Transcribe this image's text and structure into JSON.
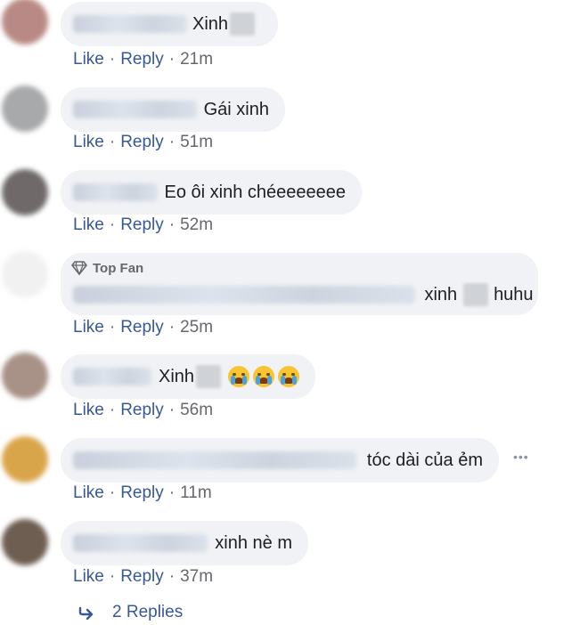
{
  "comments": [
    {
      "text": "Xinh",
      "like": "Like",
      "reply": "Reply",
      "time": "21m"
    },
    {
      "text": "Gái xinh",
      "like": "Like",
      "reply": "Reply",
      "time": "51m"
    },
    {
      "text": "Eo ôi xinh chéeeeeeee",
      "like": "Like",
      "reply": "Reply",
      "time": "52m"
    },
    {
      "badge": "Top Fan",
      "text_a": "xinh",
      "text_b": "huhu",
      "like": "Like",
      "reply": "Reply",
      "time": "25m"
    },
    {
      "text": "Xinh",
      "emoji": "crying-face-emoji",
      "like": "Like",
      "reply": "Reply",
      "time": "56m"
    },
    {
      "text": "tóc dài của ẻm",
      "more": "•••",
      "like": "Like",
      "reply": "Reply",
      "time": "11m"
    },
    {
      "text": "xinh nè m",
      "like": "Like",
      "reply": "Reply",
      "time": "37m"
    }
  ],
  "replies": {
    "label": "2 Replies",
    "icon": "reply-arrow-icon"
  },
  "colors": {
    "link": "#385898",
    "meta": "#65676b",
    "bubble": "#f0f2f5"
  }
}
